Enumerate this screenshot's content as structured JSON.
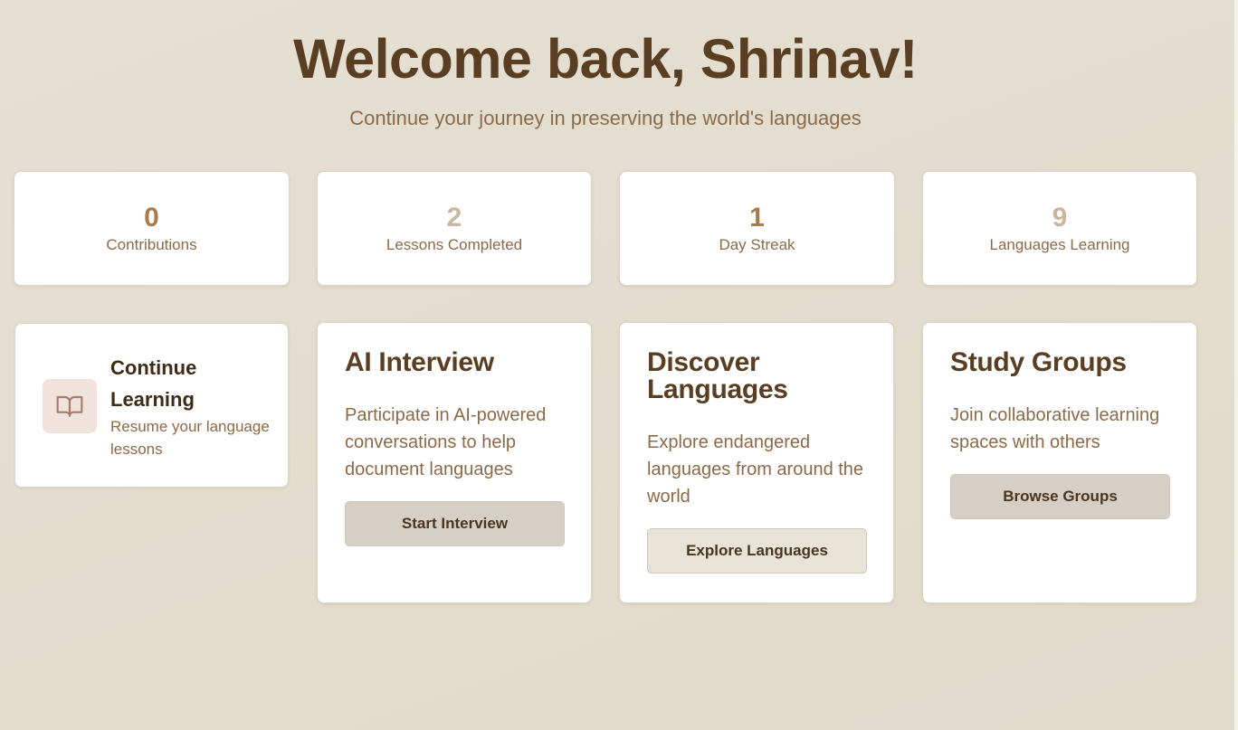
{
  "header": {
    "title": "Welcome back, Shrinav!",
    "subtitle": "Continue your journey in preserving the world's languages"
  },
  "stats": [
    {
      "value": "0",
      "label": "Contributions",
      "color": "#a67c4b"
    },
    {
      "value": "2",
      "label": "Lessons Completed",
      "color": "#c9b89f"
    },
    {
      "value": "1",
      "label": "Day Streak",
      "color": "#a67c4b"
    },
    {
      "value": "9",
      "label": "Languages Learning",
      "color": "#c9b89f"
    }
  ],
  "continue_learning": {
    "title": "Continue Learning",
    "subtitle": "Resume your language lessons",
    "icon": "book-open-icon"
  },
  "features": [
    {
      "title": "AI Interview",
      "description": "Participate in AI-powered conversations to help document languages",
      "button": "Start Interview"
    },
    {
      "title": "Discover Languages",
      "description": "Explore endangered languages from around the world",
      "button": "Explore Languages"
    },
    {
      "title": "Study Groups",
      "description": "Join collaborative learning spaces with others",
      "button": "Browse Groups"
    }
  ],
  "colors": {
    "heading": "#5a3e22",
    "muted": "#8b6a4a",
    "background": "#e2dccd",
    "button": "#d6cfc5"
  }
}
